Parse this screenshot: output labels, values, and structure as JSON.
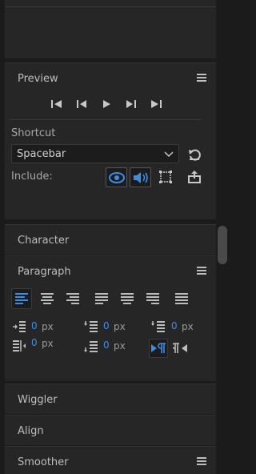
{
  "preview": {
    "title": "Preview",
    "shortcut_label": "Shortcut",
    "shortcut_value": "Spacebar",
    "include_label": "Include:"
  },
  "character": {
    "title": "Character"
  },
  "paragraph": {
    "title": "Paragraph",
    "indent_left": "0",
    "indent_right": "0",
    "first_line_indent": "0",
    "space_before": "0",
    "space_after": "0",
    "unit": "px"
  },
  "wiggler": {
    "title": "Wiggler"
  },
  "align": {
    "title": "Align"
  },
  "smoother": {
    "title": "Smoother"
  },
  "colors": {
    "accent": "#3a8ee6",
    "bg": "#262626"
  }
}
